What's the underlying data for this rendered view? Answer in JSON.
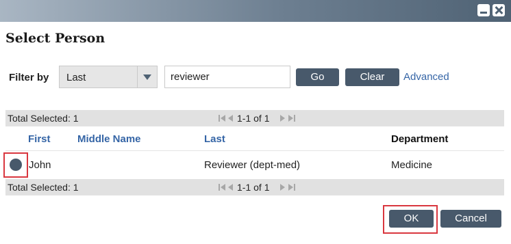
{
  "dialog": {
    "title": "Select Person"
  },
  "filter": {
    "label": "Filter by",
    "field_selected": "Last",
    "query": "reviewer",
    "go_label": "Go",
    "clear_label": "Clear",
    "advanced_label": "Advanced"
  },
  "pagination": {
    "total_selected": "Total Selected: 1",
    "range": "1-1 of 1"
  },
  "table": {
    "columns": [
      "First",
      "Middle Name",
      "Last",
      "Department"
    ],
    "rows": [
      {
        "selected": true,
        "first": "John",
        "middle": "",
        "last": "Reviewer (dept-med)",
        "department": "Medicine"
      }
    ]
  },
  "footer": {
    "ok_label": "OK",
    "cancel_label": "Cancel"
  },
  "colors": {
    "title_bar": "#6d7f91",
    "button": "#48596b",
    "link": "#3565a6",
    "highlight": "#d9363e"
  },
  "icons": [
    "minimize-icon",
    "close-icon",
    "dropdown-arrow-icon",
    "first-page-icon",
    "prev-page-icon",
    "next-page-icon",
    "last-page-icon"
  ]
}
